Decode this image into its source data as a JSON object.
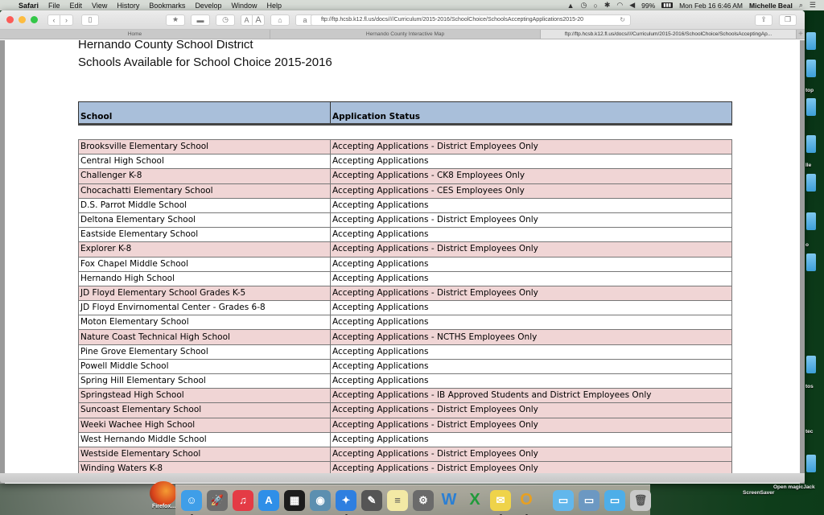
{
  "menubar": {
    "app": "Safari",
    "items": [
      "File",
      "Edit",
      "View",
      "History",
      "Bookmarks",
      "Develop",
      "Window",
      "Help"
    ],
    "battery": "99%",
    "datetime": "Mon Feb 16  6:46 AM",
    "user": "Michelle Beal"
  },
  "browser": {
    "url": "ftp://ftp.hcsb.k12.fl.us/docs////Curriculum/2015-2016/SchoolChoice/SchoolsAcceptingApplications2015-20",
    "tabs": [
      {
        "label": "Home",
        "active": false
      },
      {
        "label": "Hernando County Interactive Map",
        "active": false
      },
      {
        "label": "ftp://ftp.hcsb.k12.fl.us/docs////Curriculum/2015-2016/SchoolChoice/SchoolsAcceptingAp...",
        "active": true
      }
    ],
    "font_small": "A",
    "font_large": "A",
    "amazon_label": "a",
    "new_tab": "+"
  },
  "page": {
    "title_line1": "Hernando County School District",
    "title_line2": "Schools Available for School Choice 2015-2016",
    "headers": {
      "school": "School",
      "status": "Application Status"
    },
    "colors": {
      "header_bg": "#a9bfda",
      "highlight_row": "#f0d5d5"
    },
    "rows": [
      {
        "school": "Brooksville Elementary School",
        "status": "Accepting Applications - District Employees Only",
        "highlight": true
      },
      {
        "school": "Central High School",
        "status": "Accepting Applications",
        "highlight": false
      },
      {
        "school": "Challenger K-8",
        "status": "Accepting Applications - CK8 Employees Only",
        "highlight": true
      },
      {
        "school": "Chocachatti Elementary School",
        "status": "Accepting Applications - CES Employees Only",
        "highlight": true
      },
      {
        "school": "D.S. Parrot Middle School",
        "status": "Accepting Applications",
        "highlight": false
      },
      {
        "school": "Deltona Elementary School",
        "status": "Accepting Applications - District Employees Only",
        "highlight": false
      },
      {
        "school": "Eastside Elementary School",
        "status": "Accepting Applications",
        "highlight": false
      },
      {
        "school": "Explorer K-8",
        "status": "Accepting Applications - District Employees Only",
        "highlight": true
      },
      {
        "school": "Fox Chapel Middle School",
        "status": "Accepting Applications",
        "highlight": false
      },
      {
        "school": "Hernando High School",
        "status": "Accepting Applications",
        "highlight": false
      },
      {
        "school": "JD Floyd Elementary School Grades K-5",
        "status": "Accepting Applications - District Employees Only",
        "highlight": true
      },
      {
        "school": "JD Floyd Envirnomental Center - Grades 6-8",
        "status": "Accepting Applications",
        "highlight": false
      },
      {
        "school": "Moton Elementary School",
        "status": "Accepting Applications",
        "highlight": false
      },
      {
        "school": "Nature Coast Technical High School",
        "status": "Accepting Applications - NCTHS Employees Only",
        "highlight": true
      },
      {
        "school": "Pine Grove Elementary School",
        "status": "Accepting Applications",
        "highlight": false
      },
      {
        "school": "Powell Middle School",
        "status": "Accepting Applications",
        "highlight": false
      },
      {
        "school": "Spring Hill Elementary School",
        "status": "Accepting Applications",
        "highlight": false
      },
      {
        "school": "Springstead High School",
        "status": "Accepting Applications - IB Approved Students and District Employees Only",
        "highlight": true
      },
      {
        "school": "Suncoast Elementary School",
        "status": "Accepting Applications - District Employees Only",
        "highlight": true
      },
      {
        "school": "Weeki Wachee High School",
        "status": "Accepting Applications - District Employees Only",
        "highlight": true
      },
      {
        "school": "West Hernando Middle School",
        "status": "Accepting Applications",
        "highlight": false
      },
      {
        "school": "Westside Elementary School",
        "status": "Accepting Applications - District Employees Only",
        "highlight": true
      },
      {
        "school": "Winding Waters K-8",
        "status": "Accepting Applications - District Employees Only",
        "highlight": true
      }
    ]
  },
  "desktop": {
    "labels": [
      "top",
      "lle",
      "o",
      "tos",
      "tec",
      "ScreenSaver",
      "Open magicJack",
      "Firefox..."
    ]
  },
  "dock": {
    "items": [
      {
        "name": "finder",
        "glyph": "☺",
        "color": "#3f9ee8",
        "running": true
      },
      {
        "name": "launchpad",
        "glyph": "🚀",
        "color": "#6d6d6d",
        "running": false
      },
      {
        "name": "itunes",
        "glyph": "♫",
        "color": "#e43b45",
        "running": false
      },
      {
        "name": "app-store",
        "glyph": "A",
        "color": "#2f8fe8",
        "running": false
      },
      {
        "name": "mission-control",
        "glyph": "▦",
        "color": "#1c1c1c",
        "running": false
      },
      {
        "name": "iphoto",
        "glyph": "◉",
        "color": "#5c8fb0",
        "running": false
      },
      {
        "name": "safari",
        "glyph": "✦",
        "color": "#2e7fe0",
        "running": true
      },
      {
        "name": "utility",
        "glyph": "✎",
        "color": "#555555",
        "running": false
      },
      {
        "name": "notes",
        "glyph": "≡",
        "color": "#f3e9a5",
        "running": false
      },
      {
        "name": "system-preferences",
        "glyph": "⚙",
        "color": "#6a6a6a",
        "running": false
      },
      {
        "name": "word",
        "glyph": "W",
        "color": "#2a7fd4",
        "running": false
      },
      {
        "name": "excel",
        "glyph": "X",
        "color": "#1f9a3a",
        "running": false
      },
      {
        "name": "stickies",
        "glyph": "✉",
        "color": "#efd34a",
        "running": true
      },
      {
        "name": "outlook",
        "glyph": "O",
        "color": "#e8a020",
        "running": true
      },
      {
        "name": "documents-folder",
        "glyph": "▭",
        "color": "#62b7ec",
        "running": false
      },
      {
        "name": "applications-folder",
        "glyph": "▭",
        "color": "#6c98c2",
        "running": false
      },
      {
        "name": "downloads-folder",
        "glyph": "▭",
        "color": "#4eaee8",
        "running": false
      },
      {
        "name": "trash",
        "glyph": "🗑",
        "color": "#c9c9c9",
        "running": false
      }
    ]
  }
}
